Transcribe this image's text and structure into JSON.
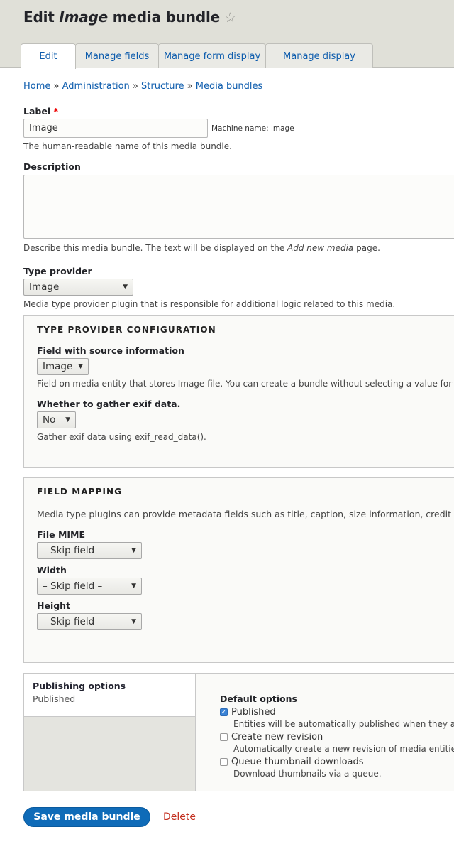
{
  "header": {
    "title_prefix": "Edit ",
    "title_em": "Image",
    "title_suffix": " media bundle",
    "star_icon": "☆",
    "tabs": [
      {
        "label": "Edit",
        "active": true
      },
      {
        "label": "Manage fields",
        "active": false
      },
      {
        "label": "Manage form display",
        "active": false
      },
      {
        "label": "Manage display",
        "active": false
      }
    ]
  },
  "breadcrumb": {
    "items": [
      "Home",
      "Administration",
      "Structure",
      "Media bundles"
    ],
    "separator": "»"
  },
  "label_field": {
    "label": "Label",
    "required_marker": "*",
    "value": "Image",
    "machine_name": "Machine name: image",
    "description": "The human-readable name of this media bundle."
  },
  "description_field": {
    "label": "Description",
    "value": "",
    "help_prefix": "Describe this media bundle. The text will be displayed on the ",
    "help_em": "Add new media",
    "help_suffix": " page."
  },
  "type_provider": {
    "label": "Type provider",
    "selected": "Image",
    "description": "Media type provider plugin that is responsible for additional logic related to this media."
  },
  "type_provider_config": {
    "legend": "Type provider configuration",
    "source_field": {
      "label": "Field with source information",
      "selected": "Image",
      "description": "Field on media entity that stores Image file. You can create a bundle without selecting a value for t"
    },
    "exif": {
      "label": "Whether to gather exif data.",
      "selected": "No",
      "description": "Gather exif data using exif_read_data()."
    }
  },
  "field_mapping": {
    "legend": "Field mapping",
    "intro": "Media type plugins can provide metadata fields such as title, caption, size information, credit",
    "fields": [
      {
        "label": "File MIME",
        "selected": "– Skip field –"
      },
      {
        "label": "Width",
        "selected": "– Skip field –"
      },
      {
        "label": "Height",
        "selected": "– Skip field –"
      }
    ]
  },
  "publishing": {
    "tab_title": "Publishing options",
    "tab_summary": "Published",
    "group_label": "Default options",
    "options": [
      {
        "label": "Published",
        "checked": true,
        "description": "Entities will be automatically published when they ar"
      },
      {
        "label": "Create new revision",
        "checked": false,
        "description": "Automatically create a new revision of media entities"
      },
      {
        "label": "Queue thumbnail downloads",
        "checked": false,
        "description": "Download thumbnails via a queue."
      }
    ]
  },
  "actions": {
    "save_label": "Save media bundle",
    "delete_label": "Delete"
  },
  "colors": {
    "link": "#0d5cad",
    "primary_button": "#0f6bb8",
    "delete": "#c32f1f",
    "required": "#e00000"
  }
}
